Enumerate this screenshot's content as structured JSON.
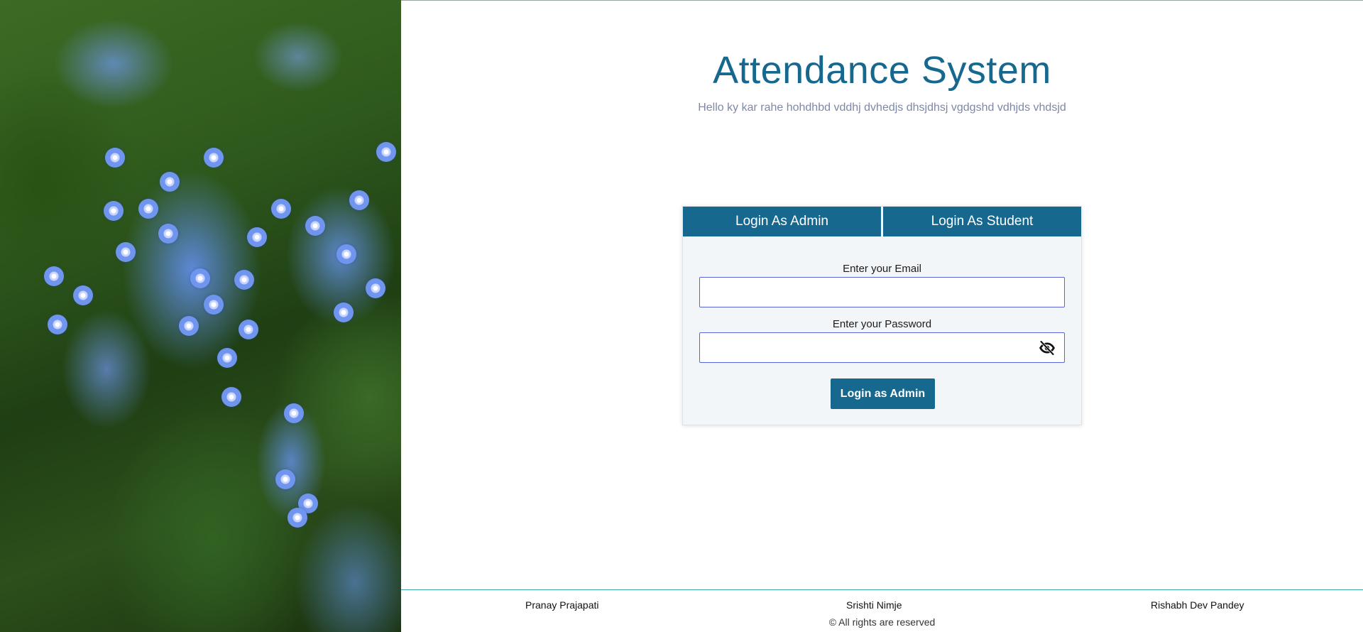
{
  "header": {
    "title": "Attendance System",
    "subtitle": "Hello ky kar rahe hohdhbd vddhj dvhedjs dhsjdhsj vgdgshd vdhjds vhdsjd"
  },
  "login": {
    "tabs": [
      {
        "label": "Login As Admin",
        "active": true
      },
      {
        "label": "Login As Student",
        "active": false
      }
    ],
    "email": {
      "label": "Enter your Email",
      "value": "",
      "placeholder": ""
    },
    "password": {
      "label": "Enter your Password",
      "value": "",
      "placeholder": "",
      "toggle_icon": "eye-off-icon"
    },
    "submit_label": "Login as Admin"
  },
  "footer": {
    "authors": [
      "Pranay Prajapati",
      "Srishti Nimje",
      "Rishabh Dev Pandey"
    ],
    "rights": "© All rights are reserved"
  },
  "colors": {
    "accent": "#16688f",
    "subtitle": "#7f88a6",
    "input_border": "#5b64d8",
    "footer_rule": "#3aa6a6",
    "card_background": "#f3f6f8"
  },
  "side_image": {
    "icon": "forget-me-not-flowers-photo"
  }
}
